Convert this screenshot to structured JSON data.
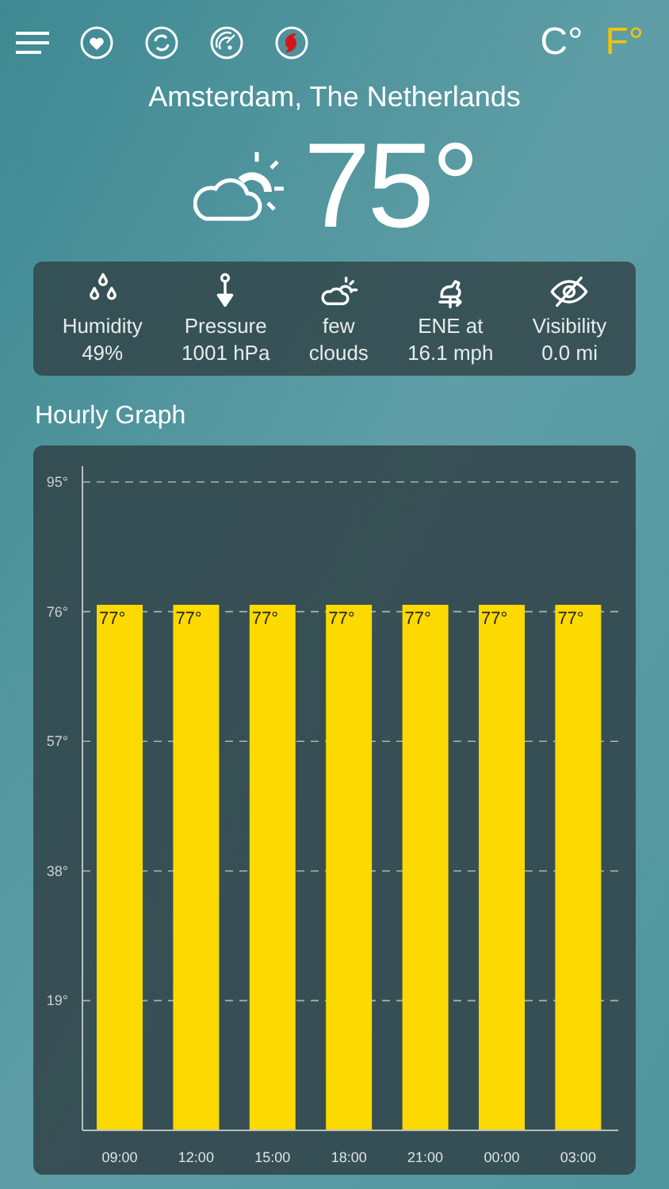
{
  "units": [
    {
      "label": "C°",
      "selected": false
    },
    {
      "label": "F°",
      "selected": true
    }
  ],
  "location": "Amsterdam, The Netherlands",
  "temperature": "75°",
  "stats": [
    {
      "kind": "humidity",
      "lines": [
        "Humidity",
        "49%"
      ]
    },
    {
      "kind": "pressure",
      "lines": [
        "Pressure",
        "1001 hPa"
      ]
    },
    {
      "kind": "clouds",
      "lines": [
        "few",
        "clouds"
      ]
    },
    {
      "kind": "wind",
      "lines": [
        "ENE at",
        "16.1 mph"
      ]
    },
    {
      "kind": "visibility",
      "lines": [
        "Visibility",
        "0.0 mi"
      ]
    }
  ],
  "hourly_graph": {
    "title": "Hourly Graph",
    "chart_data": {
      "type": "bar",
      "categories": [
        "09:00",
        "12:00",
        "15:00",
        "18:00",
        "21:00",
        "00:00",
        "03:00"
      ],
      "grid": true,
      "series": [
        {
          "color": "#fcd900",
          "values": [
            77,
            77,
            77,
            77,
            77,
            77,
            77
          ]
        }
      ],
      "ylim": [
        0,
        95
      ],
      "yticks": [
        {
          "value": 19,
          "label": "19°"
        },
        {
          "value": 38,
          "label": "38°"
        },
        {
          "value": 57,
          "label": "57°"
        },
        {
          "value": 76,
          "label": "76°"
        },
        {
          "value": 95,
          "label": "95°"
        }
      ],
      "value_labels": [
        "77°",
        "77°",
        "77°",
        "77°",
        "77°",
        "77°",
        "77°"
      ]
    }
  }
}
